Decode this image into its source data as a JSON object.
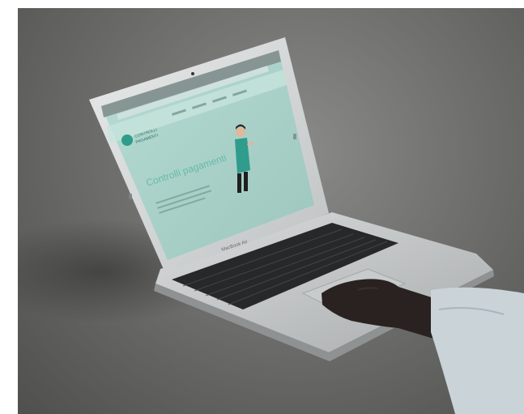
{
  "scene": {
    "background_color": "#6f6f6d",
    "screen_tint": "#a9cfc7",
    "accent_teal": "#2f9c8c"
  },
  "laptop": {
    "brand_label": "MacBook Air"
  },
  "website": {
    "logo_text_line1": "CONTROLLI",
    "logo_text_line2": "PAGAMENTI",
    "headline": "Controlli pagamenti",
    "nav_items": [
      "",
      "",
      "",
      "",
      ""
    ]
  },
  "icons": [
    "browser-window",
    "person-illustration",
    "hand"
  ]
}
